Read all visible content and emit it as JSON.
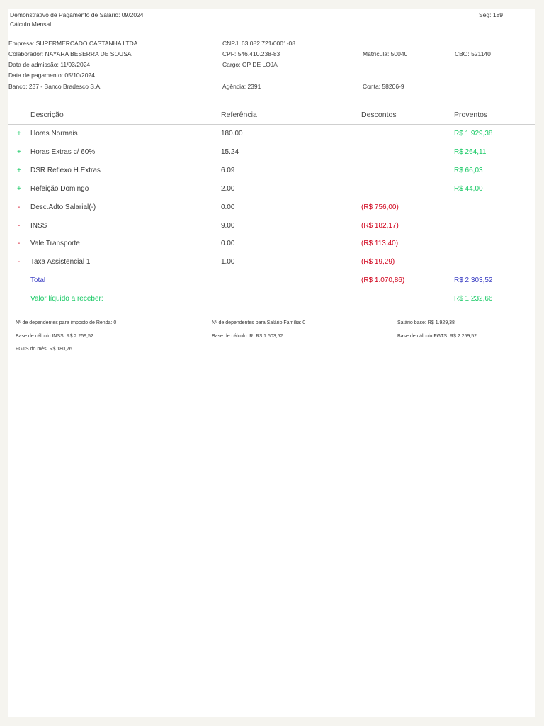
{
  "header": {
    "title": "Demonstrativo de Pagamento de Salário: 09/2024",
    "subtitle": "Cálculo Mensal",
    "seg": "Seg: 189"
  },
  "info": {
    "empresa": "Empresa: SUPERMERCADO CASTANHA LTDA",
    "cnpj": "CNPJ: 63.082.721/0001-08",
    "colaborador": "Colaborador: NAYARA BESERRA DE SOUSA",
    "cpf": "CPF: 546.410.238-83",
    "matricula": "Matrícula: 50040",
    "cbo": "CBO: 521140",
    "admissao": "Data de admissão: 11/03/2024",
    "cargo": "Cargo: OP DE LOJA",
    "pagamento": "Data de pagamento: 05/10/2024",
    "banco": "Banco: 237 - Banco Bradesco S.A.",
    "agencia": "Agência: 2391",
    "conta": "Conta: 58206-9"
  },
  "columns": {
    "descricao": "Descrição",
    "referencia": "Referência",
    "descontos": "Descontos",
    "proventos": "Proventos"
  },
  "items": [
    {
      "sign": "+",
      "desc": "Horas Normais",
      "ref": "180.00",
      "desconto": "",
      "provento": "R$ 1.929,38"
    },
    {
      "sign": "+",
      "desc": "Horas Extras c/ 60%",
      "ref": "15.24",
      "desconto": "",
      "provento": "R$ 264,11"
    },
    {
      "sign": "+",
      "desc": "DSR Reflexo H.Extras",
      "ref": "6.09",
      "desconto": "",
      "provento": "R$ 66,03"
    },
    {
      "sign": "+",
      "desc": "Refeição Domingo",
      "ref": "2.00",
      "desconto": "",
      "provento": "R$ 44,00"
    },
    {
      "sign": "-",
      "desc": "Desc.Adto Salarial(-)",
      "ref": "0.00",
      "desconto": "(R$ 756,00)",
      "provento": ""
    },
    {
      "sign": "-",
      "desc": "INSS",
      "ref": "9.00",
      "desconto": "(R$ 182,17)",
      "provento": ""
    },
    {
      "sign": "-",
      "desc": "Vale Transporte",
      "ref": "0.00",
      "desconto": "(R$ 113,40)",
      "provento": ""
    },
    {
      "sign": "-",
      "desc": "Taxa Assistencial 1",
      "ref": "1.00",
      "desconto": "(R$ 19,29)",
      "provento": ""
    }
  ],
  "total": {
    "label": "Total",
    "descontos": "(R$ 1.070,86)",
    "proventos": "R$ 2.303,52"
  },
  "liquido": {
    "label": "Valor líquido a receber:",
    "value": "R$ 1.232,66"
  },
  "footer": {
    "dep_ir": "Nº de dependentes para imposto de Renda: 0",
    "dep_sf": "Nº de dependentes para Salário Família: 0",
    "salario_base": "Salário base: R$ 1.929,38",
    "base_inss": "Base de cálculo INSS: R$ 2.259,52",
    "base_ir": "Base de cálculo IR: R$ 1.503,52",
    "base_fgts": "Base de cálculo FGTS: R$ 2.259,52",
    "fgts_mes": "FGTS do mês: R$ 180,76"
  },
  "colors": {
    "positive": "#17c964",
    "negative": "#d0021b",
    "total": "#3b3fc4"
  }
}
